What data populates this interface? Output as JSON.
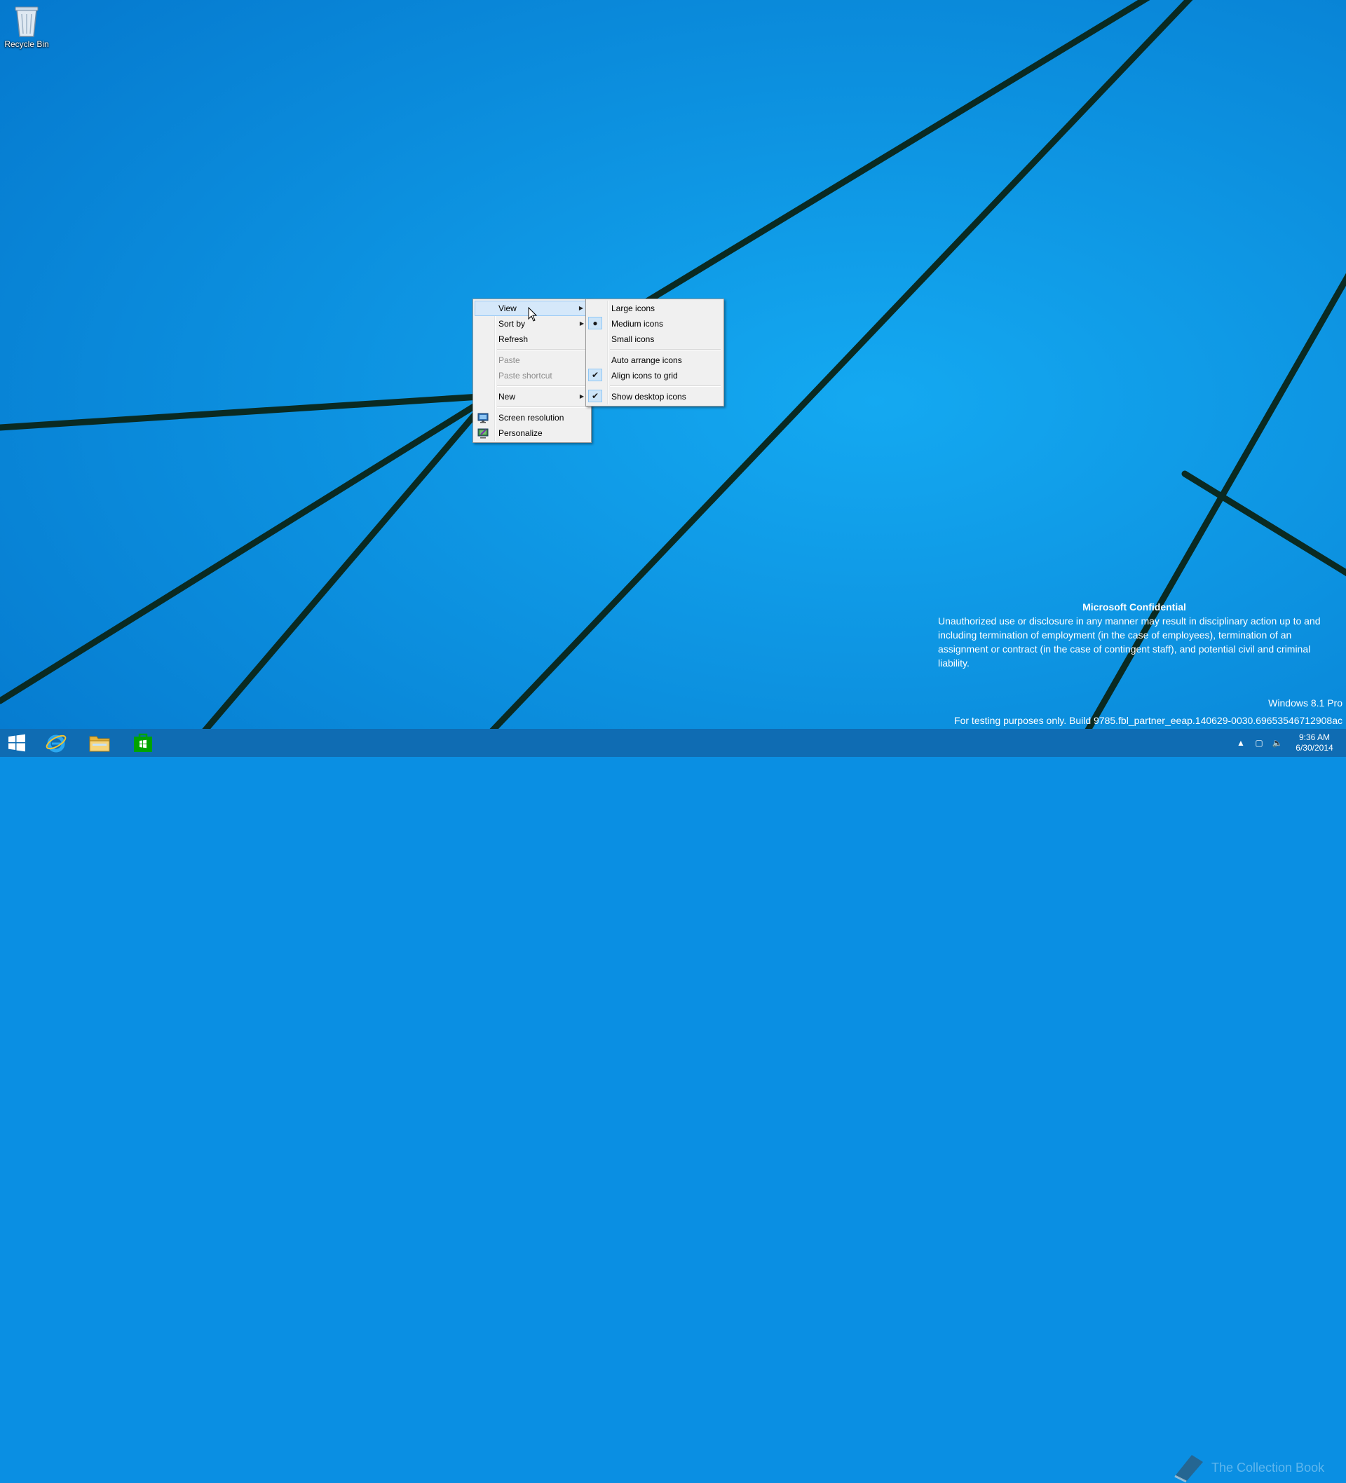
{
  "desktop": {
    "recycle_bin_label": "Recycle Bin"
  },
  "context_menu": {
    "items": [
      {
        "label": "View"
      },
      {
        "label": "Sort by"
      },
      {
        "label": "Refresh"
      },
      {
        "label": "Paste"
      },
      {
        "label": "Paste shortcut"
      },
      {
        "label": "New"
      },
      {
        "label": "Screen resolution"
      },
      {
        "label": "Personalize"
      }
    ]
  },
  "view_submenu": {
    "items": [
      {
        "label": "Large icons"
      },
      {
        "label": "Medium icons"
      },
      {
        "label": "Small icons"
      },
      {
        "label": "Auto arrange icons"
      },
      {
        "label": "Align icons to grid"
      },
      {
        "label": "Show desktop icons"
      }
    ]
  },
  "notice": {
    "title": "Microsoft Confidential",
    "body": "Unauthorized use or disclosure in any manner may result in disciplinary action up to and including termination of employment (in the case of employees), termination of an assignment or contract (in the case of contingent staff), and potential civil and criminal liability.",
    "edition": "Windows 8.1 Pro",
    "build": "For testing purposes only. Build 9785.fbl_partner_eeap.140629-0030.69653546712908ac"
  },
  "taskbar": {
    "clock_time": "9:36 AM",
    "clock_date": "6/30/2014",
    "watermark_text": "The Collection Book"
  },
  "colors": {
    "desktop_bg": "#0a8fe3",
    "menu_highlight": "#d5e8fa",
    "store_green": "#00a300"
  }
}
